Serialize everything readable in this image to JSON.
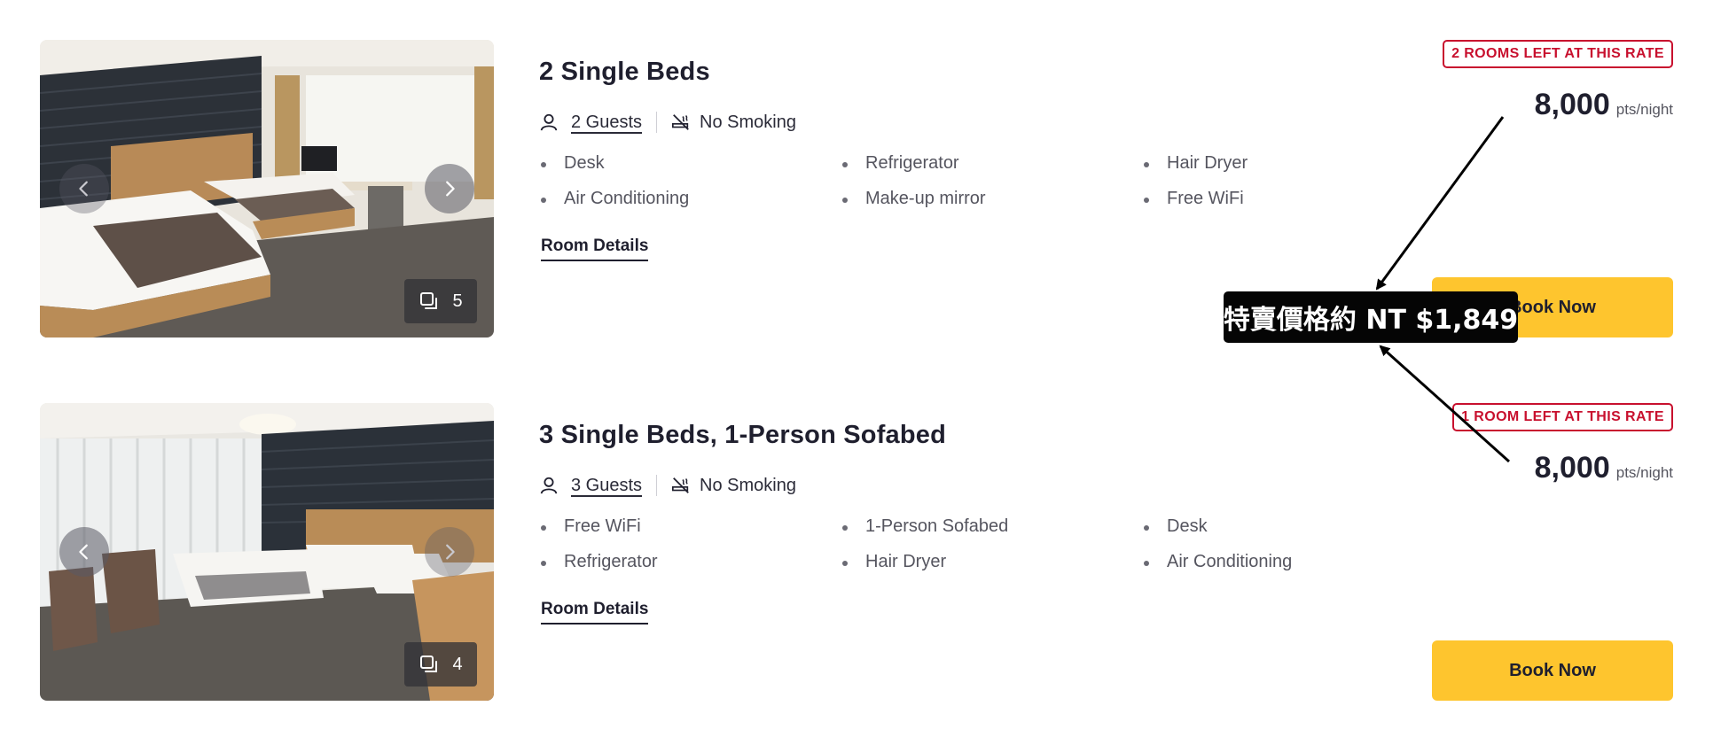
{
  "rooms": [
    {
      "title": "2 Single Beds",
      "guests": "2 Guests",
      "smoking": "No Smoking",
      "amenities": [
        "Desk",
        "Refrigerator",
        "Hair Dryer",
        "Air Conditioning",
        "Make-up mirror",
        "Free WiFi"
      ],
      "details_label": "Room Details",
      "availability": "2 ROOMS LEFT AT THIS RATE",
      "price": "8,000",
      "price_unit": "pts/night",
      "book_label": "Book Now",
      "photo_count": "5",
      "icons": {
        "prev": "chevron-left-icon",
        "next": "chevron-right-icon",
        "gallery": "gallery-icon",
        "person": "person-icon",
        "no_smoking": "no-smoking-icon"
      }
    },
    {
      "title": "3 Single Beds, 1-Person Sofabed",
      "guests": "3 Guests",
      "smoking": "No Smoking",
      "amenities": [
        "Free WiFi",
        "1-Person Sofabed",
        "Desk",
        "Refrigerator",
        "Hair Dryer",
        "Air Conditioning"
      ],
      "details_label": "Room Details",
      "availability": "1 ROOM LEFT AT THIS RATE",
      "price": "8,000",
      "price_unit": "pts/night",
      "book_label": "Book Now",
      "photo_count": "4",
      "icons": {
        "prev": "chevron-left-icon",
        "next": "chevron-right-icon",
        "gallery": "gallery-icon",
        "person": "person-icon",
        "no_smoking": "no-smoking-icon"
      }
    }
  ],
  "annotation": {
    "text": "特賣價格約 NT $1,849",
    "background": "#050505",
    "color": "#ffffff"
  },
  "colors": {
    "accent_button": "#fec52e",
    "badge_red": "#c8102e",
    "text_dark": "#1f1f2e",
    "text_muted": "#55555f"
  }
}
